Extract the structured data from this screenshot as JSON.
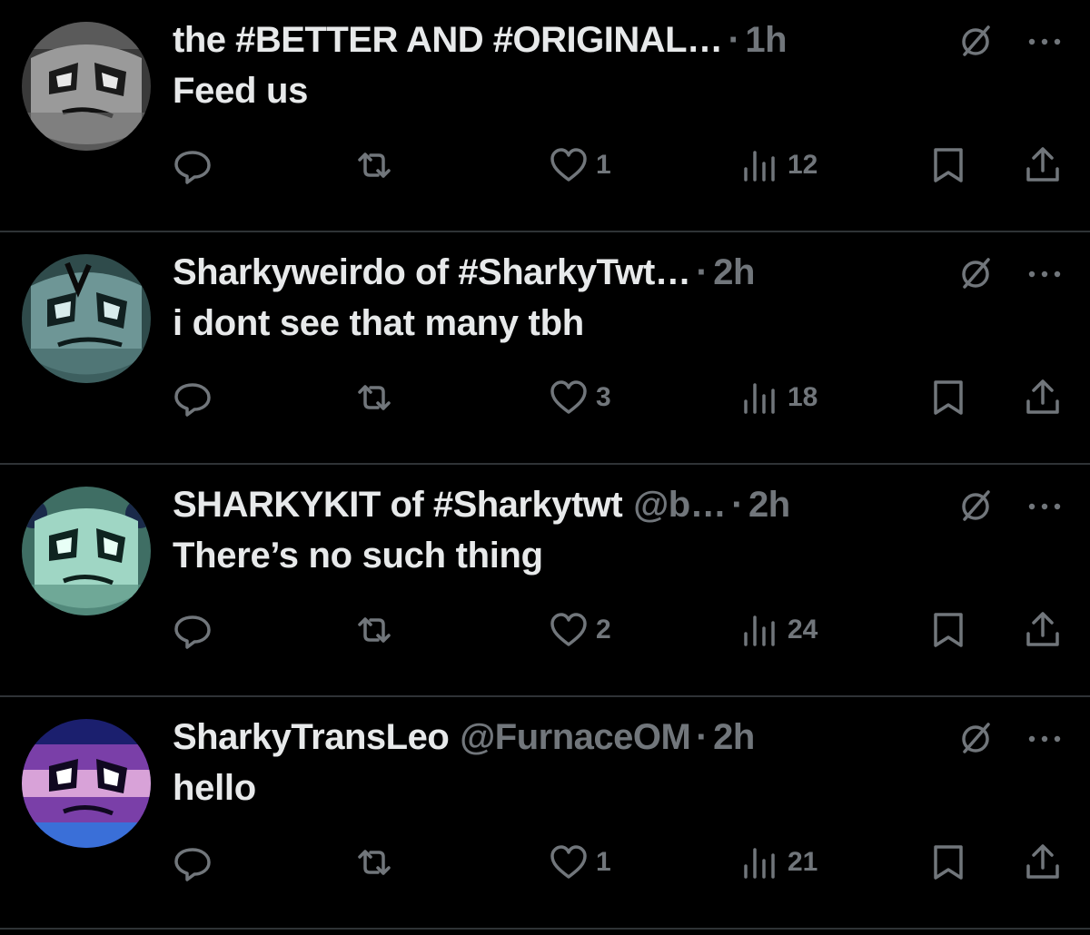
{
  "colors": {
    "background": "#000000",
    "primary_text": "#e7e9ea",
    "secondary_text": "#71767b",
    "divider": "#2f3336"
  },
  "icons": [
    "reply-icon",
    "retweet-icon",
    "like-icon",
    "views-icon",
    "bookmark-icon",
    "share-icon",
    "grok-icon",
    "more-icon"
  ],
  "tweets": [
    {
      "display_name": "the #BETTER AND #ORIGINAL…",
      "handle": "",
      "separator": "·",
      "time": "1h",
      "text": "Feed us",
      "likes": "1",
      "views": "12",
      "avatar_tint": "#b8b8b8"
    },
    {
      "display_name": "Sharkyweirdo of #SharkyTwt…",
      "handle": "",
      "separator": "·",
      "time": "2h",
      "text": "i dont see that many tbh",
      "likes": "3",
      "views": "18",
      "avatar_tint": "#5f8a8a"
    },
    {
      "display_name": "SHARKYKIT of #Sharkytwt",
      "handle": "@b…",
      "separator": "·",
      "time": "2h",
      "text": "There’s no such thing",
      "likes": "2",
      "views": "24",
      "avatar_tint": "#8fc7b4"
    },
    {
      "display_name": "SharkyTransLeo",
      "handle": "@FurnaceOM",
      "separator": "·",
      "time": "2h",
      "text": "hello",
      "likes": "1",
      "views": "21",
      "avatar_tint": "#d9a6d6"
    }
  ]
}
